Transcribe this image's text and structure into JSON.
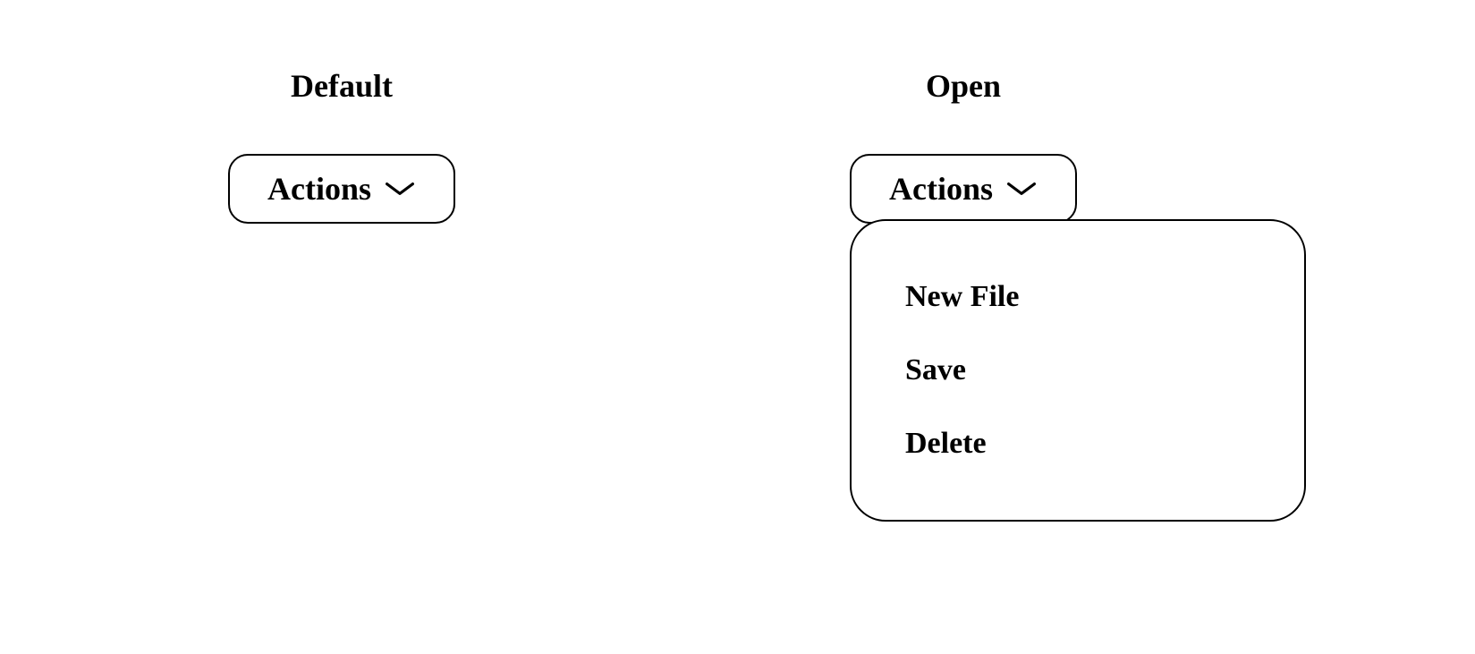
{
  "states": {
    "default": {
      "label": "Default"
    },
    "open": {
      "label": "Open"
    }
  },
  "dropdown": {
    "button_label": "Actions",
    "items": [
      {
        "label": "New File"
      },
      {
        "label": "Save"
      },
      {
        "label": "Delete"
      }
    ]
  }
}
